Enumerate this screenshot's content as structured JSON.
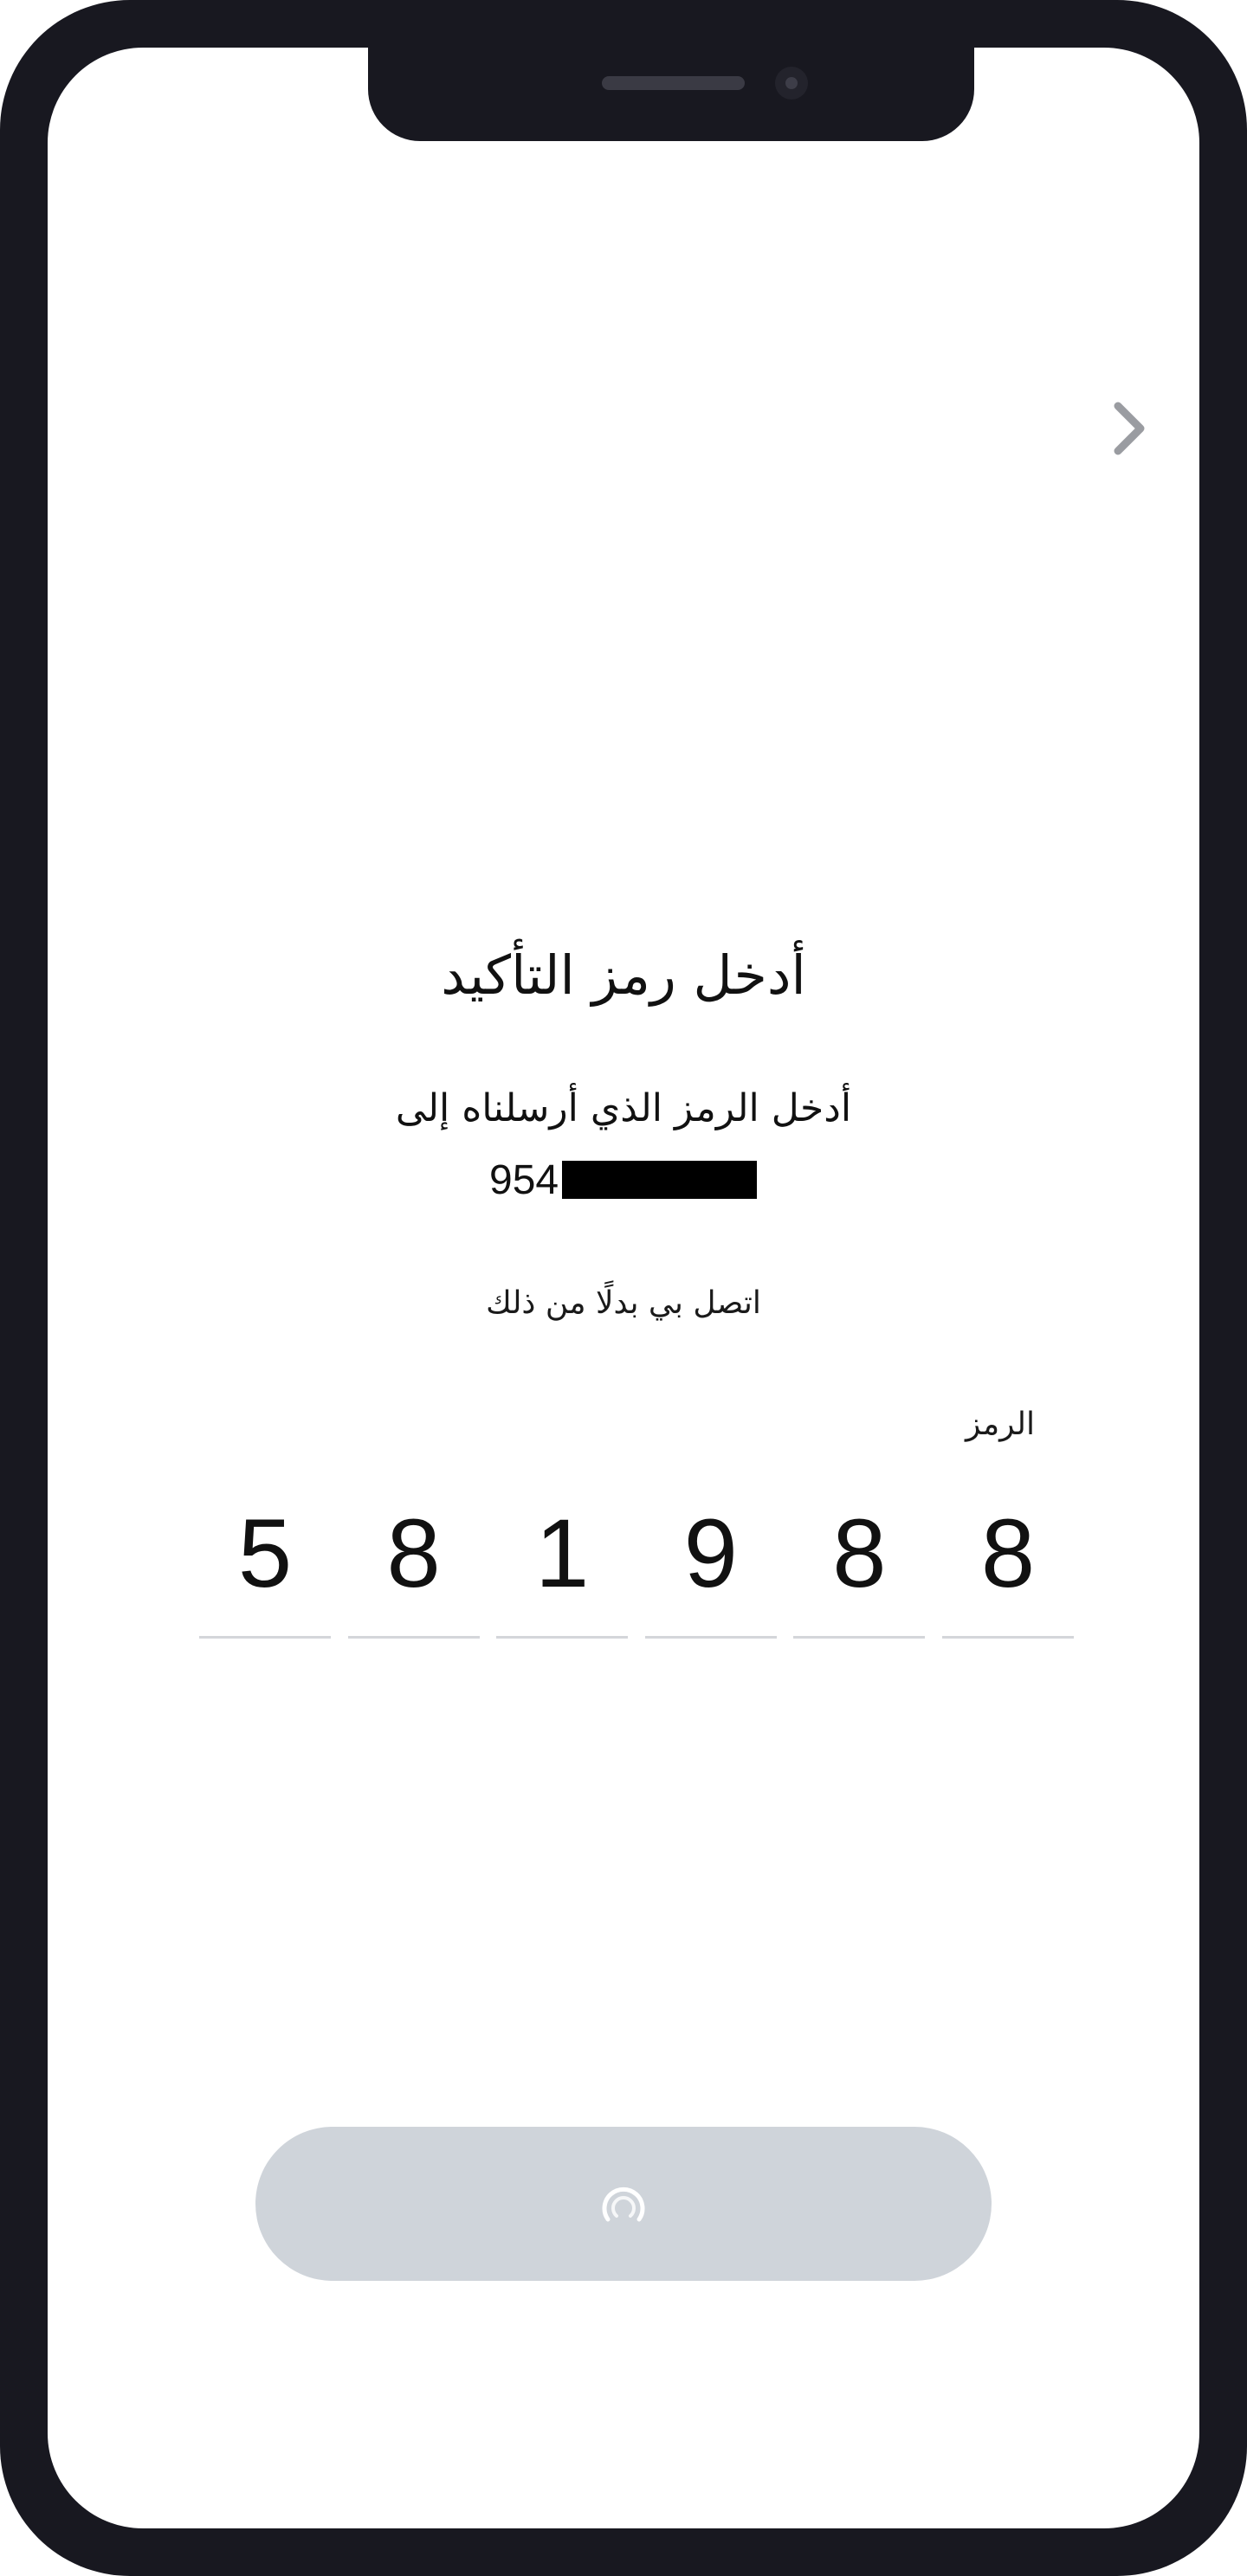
{
  "screen": {
    "title": "أدخل رمز التأكيد",
    "subtitle": "أدخل الرمز الذي أرسلناه إلى",
    "phone_prefix": "954",
    "call_instead_link": "اتصل بي بدلًا من ذلك",
    "code_label": "الرمز",
    "code_digits": [
      "5",
      "8",
      "1",
      "9",
      "8",
      "8"
    ]
  },
  "icons": {
    "nav": "chevron-right-icon",
    "button": "loading-spinner-icon"
  },
  "colors": {
    "device_frame": "#181820",
    "background": "#ffffff",
    "text": "#111111",
    "underline": "#d4d6da",
    "button_disabled": "#cfd4da",
    "spinner": "#ffffff",
    "chevron": "#9a9ca1"
  }
}
